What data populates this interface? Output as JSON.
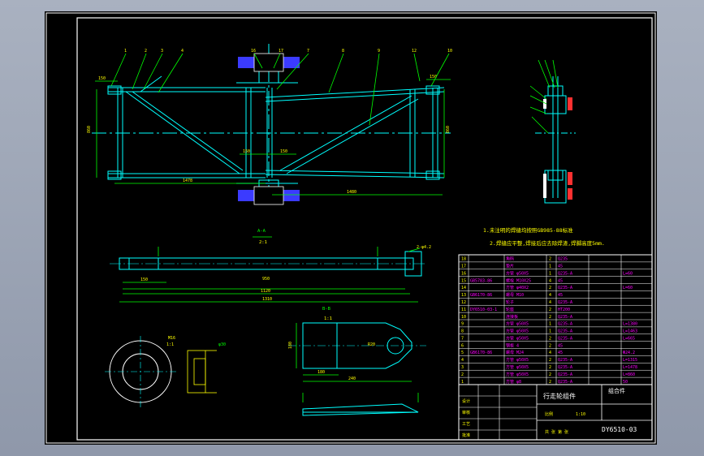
{
  "colors": {
    "background": "#000000",
    "frame": "#ffffff",
    "cyan": "#00ffff",
    "green": "#00ff00",
    "yellow": "#ffff00",
    "magenta": "#ff00ff",
    "blue": "#3b3bff",
    "red": "#ff3030"
  },
  "notes": {
    "line1": "1.未注明的焊缝均按照GB985-88标准",
    "line2": "2.焊缝应平整,焊接后应去除焊渣,焊脚高度5mm."
  },
  "views": {
    "section_a_title": "A-A",
    "section_a_scale": "2:1",
    "section_b_title": "B-B",
    "section_b_scale": "1:1",
    "part_scale": "1:1"
  },
  "dimensions": {
    "length_1": "1478",
    "length_2": "1480",
    "rail_1": "1290",
    "rail_2": "1310",
    "sub_1": "1120",
    "sub_2": "150",
    "plate_w": "240",
    "plate_h": "180",
    "hole": "2-φ4.2"
  },
  "balloons": [
    "1",
    "2",
    "3",
    "4",
    "5",
    "6",
    "7",
    "8",
    "9",
    "10",
    "11",
    "12",
    "13",
    "14",
    "15",
    "16",
    "17",
    "18"
  ],
  "bom": {
    "rows": [
      {
        "no": "18",
        "code": "",
        "name": "角码",
        "qty": "2",
        "material": "Q235",
        "note": ""
      },
      {
        "no": "17",
        "code": "",
        "name": "垫片",
        "qty": "1",
        "material": "45",
        "note": ""
      },
      {
        "no": "16",
        "code": "",
        "name": "方管 φ50X5",
        "qty": "1",
        "material": "Q235-A",
        "note": "L=60"
      },
      {
        "no": "15",
        "code": "GB5783-86",
        "name": "螺栓 M10X25",
        "qty": "4",
        "material": "45",
        "note": ""
      },
      {
        "no": "14",
        "code": "",
        "name": "方管 φ40X2",
        "qty": "2",
        "material": "Q235-A",
        "note": "L=60"
      },
      {
        "no": "13",
        "code": "GB6170-86",
        "name": "螺母 M10",
        "qty": "4",
        "material": "45",
        "note": ""
      },
      {
        "no": "12",
        "code": "",
        "name": "轮子",
        "qty": "4",
        "material": "Q235-A",
        "note": ""
      },
      {
        "no": "11",
        "code": "DY6510-03-1",
        "name": "轮座",
        "qty": "2",
        "material": "HT200",
        "note": ""
      },
      {
        "no": "10",
        "code": "",
        "name": "连接板",
        "qty": "2",
        "material": "Q235-A",
        "note": ""
      },
      {
        "no": "9",
        "code": "",
        "name": "方管 φ50X5",
        "qty": "1",
        "material": "Q235-A",
        "note": "L=1380"
      },
      {
        "no": "8",
        "code": "",
        "name": "方管 φ50X5",
        "qty": "1",
        "material": "Q235-A",
        "note": "L=1463"
      },
      {
        "no": "7",
        "code": "",
        "name": "方管 φ50X5",
        "qty": "2",
        "material": "Q235-A",
        "note": "L=665"
      },
      {
        "no": "6",
        "code": "",
        "name": "钢板 4",
        "qty": "2",
        "material": "45",
        "note": ""
      },
      {
        "no": "5",
        "code": "GB6170-86",
        "name": "螺母 M24",
        "qty": "4",
        "material": "45",
        "note": "Φ24.2"
      },
      {
        "no": "4",
        "code": "",
        "name": "方管 φ50X5",
        "qty": "2",
        "material": "Q235-A",
        "note": "L=1315"
      },
      {
        "no": "3",
        "code": "",
        "name": "方管 φ50X5",
        "qty": "2",
        "material": "Q235-A",
        "note": "L=1478"
      },
      {
        "no": "2",
        "code": "",
        "name": "方管 φ50X5",
        "qty": "2",
        "material": "Q235-A",
        "note": "L=860"
      },
      {
        "no": "1",
        "code": "",
        "name": "方管 φ8",
        "qty": "2",
        "material": "Q235-A",
        "note": "50"
      }
    ]
  },
  "title_block": {
    "name": "行走轮组件",
    "type": "组合件",
    "drawing_no": "DY6510-03",
    "scale_label": "比例",
    "scale_value": "1:10",
    "designer": "设计",
    "checker": "审核",
    "approver": "批准",
    "process": "工艺",
    "sheet": "共 张 第 张"
  }
}
